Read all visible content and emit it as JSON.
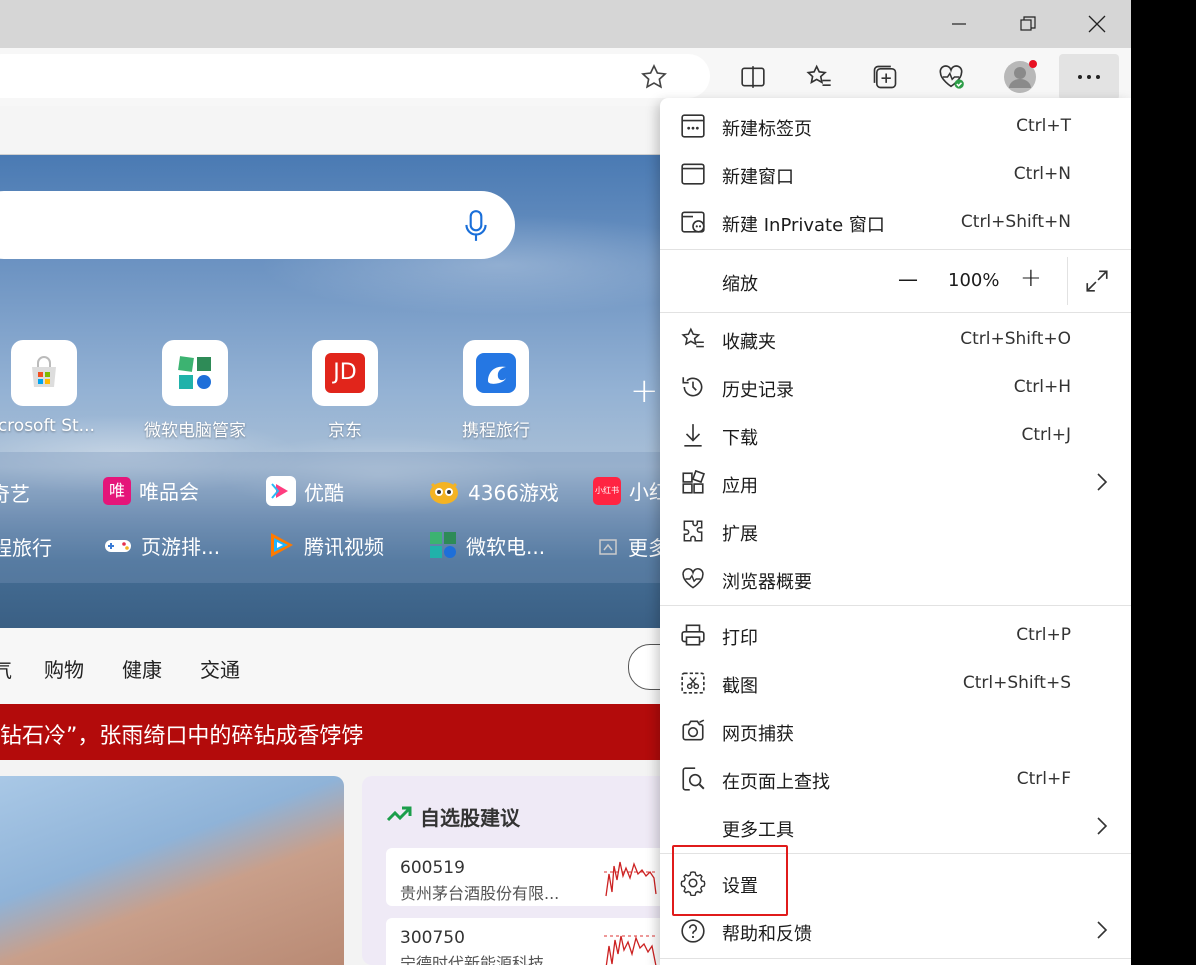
{
  "window": {
    "controls": [
      "minimize",
      "restore",
      "close"
    ]
  },
  "toolbar": {
    "icons": [
      "favorite-star-icon",
      "split-screen-icon",
      "favorites-icon",
      "collections-icon",
      "browser-essentials-icon",
      "profile-avatar-icon",
      "more-menu-icon"
    ]
  },
  "tiles": [
    {
      "label": "icrosoft St...",
      "icon": "microsoft-store-icon"
    },
    {
      "label": "微软电脑管家",
      "icon": "pc-manager-icon"
    },
    {
      "label": "京东",
      "icon": "jd-icon",
      "icon_text": "JD"
    },
    {
      "label": "携程旅行",
      "icon": "ctrip-icon"
    }
  ],
  "links_row1": [
    {
      "label": "奇艺",
      "color": "#2fb540"
    },
    {
      "label": "唯品会",
      "color": "#e5157a",
      "mini_text": "唯"
    },
    {
      "label": "优酷",
      "color": "#ffffff"
    },
    {
      "label": "4366游戏",
      "color": "#f4b323"
    },
    {
      "label": "小红",
      "color": "#ff2442",
      "mini_text": "小红书"
    }
  ],
  "links_row2": [
    {
      "label": "程旅行",
      "color": "#1e88e5"
    },
    {
      "label": "页游排...",
      "color": "#ffffff"
    },
    {
      "label": "腾讯视频",
      "color": "#ff7a00"
    },
    {
      "label": "微软电...",
      "color": "#3aa86b"
    },
    {
      "label": "更多",
      "color": "#cccccc"
    }
  ],
  "nav": [
    "气",
    "购物",
    "健康",
    "交通"
  ],
  "headline": "钻石冷”，张雨绮口中的碎钻成香饽饽",
  "stocks": {
    "title": "自选股建议",
    "items": [
      {
        "code": "600519",
        "name": "贵州茅台酒股份有限..."
      },
      {
        "code": "300750",
        "name": "宁德时代新能源科技..."
      }
    ]
  },
  "menu": {
    "items_top": [
      {
        "label": "新建标签页",
        "shortcut": "Ctrl+T",
        "icon": "new-tab-icon"
      },
      {
        "label": "新建窗口",
        "shortcut": "Ctrl+N",
        "icon": "new-window-icon"
      },
      {
        "label": "新建 InPrivate 窗口",
        "shortcut": "Ctrl+Shift+N",
        "icon": "inprivate-icon"
      }
    ],
    "zoom": {
      "label": "缩放",
      "value": "100%",
      "minus": "—",
      "plus": "+"
    },
    "items_mid": [
      {
        "label": "收藏夹",
        "shortcut": "Ctrl+Shift+O",
        "icon": "favorites-icon"
      },
      {
        "label": "历史记录",
        "shortcut": "Ctrl+H",
        "icon": "history-icon"
      },
      {
        "label": "下载",
        "shortcut": "Ctrl+J",
        "icon": "download-icon"
      },
      {
        "label": "应用",
        "shortcut": "",
        "icon": "apps-icon",
        "submenu": true
      },
      {
        "label": "扩展",
        "shortcut": "",
        "icon": "extensions-icon"
      },
      {
        "label": "浏览器概要",
        "shortcut": "",
        "icon": "browser-essentials-icon"
      }
    ],
    "items_tools": [
      {
        "label": "打印",
        "shortcut": "Ctrl+P",
        "icon": "print-icon"
      },
      {
        "label": "截图",
        "shortcut": "Ctrl+Shift+S",
        "icon": "screenshot-icon"
      },
      {
        "label": "网页捕获",
        "shortcut": "",
        "icon": "web-capture-icon"
      },
      {
        "label": "在页面上查找",
        "shortcut": "Ctrl+F",
        "icon": "find-icon"
      },
      {
        "label": "更多工具",
        "shortcut": "",
        "icon": "",
        "submenu": true
      }
    ],
    "items_bottom": [
      {
        "label": "设置",
        "shortcut": "",
        "icon": "settings-icon"
      },
      {
        "label": "帮助和反馈",
        "shortcut": "",
        "icon": "help-icon",
        "submenu": true
      }
    ]
  },
  "colors": {
    "highlight": "#e01b1b",
    "headline_bg": "#b30b0b",
    "mic": "#1a6fd9"
  }
}
